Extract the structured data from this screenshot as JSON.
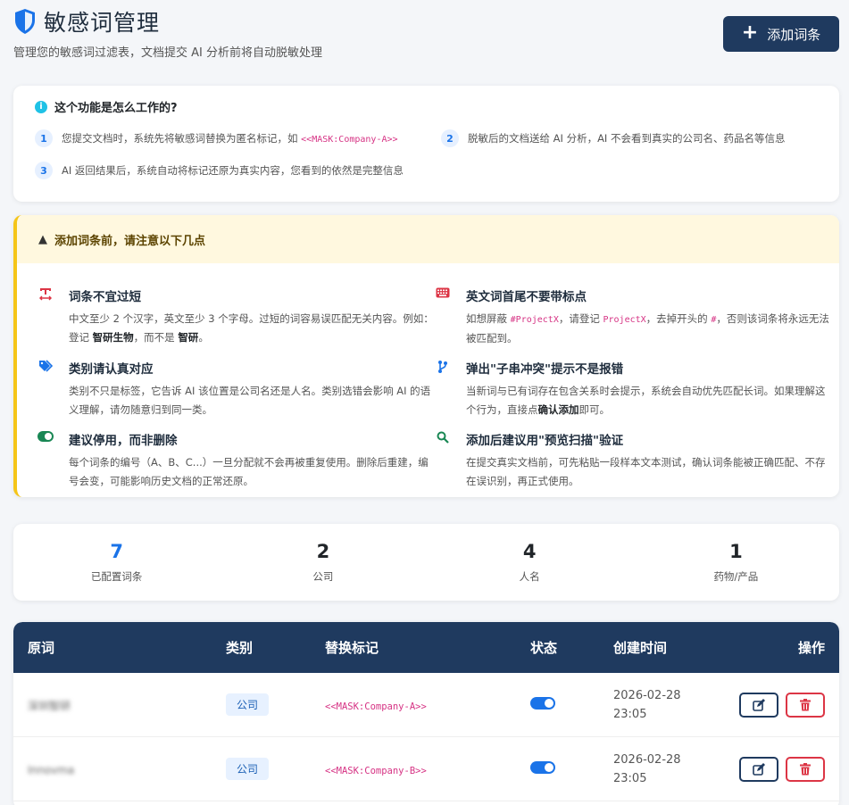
{
  "header": {
    "title": "敏感词管理",
    "subtitle": "管理您的敏感词过滤表，文档提交 AI 分析前将自动脱敏处理",
    "add_button": "添加词条"
  },
  "how_it_works": {
    "title": "这个功能是怎么工作的?",
    "steps": [
      {
        "num": "1",
        "text_before": "您提交文档时，系统先将敏感词替换为匿名标记，如 ",
        "code": "<<MASK:Company-A>>",
        "text_after": ""
      },
      {
        "num": "2",
        "text_before": "脱敏后的文档送给 AI 分析，AI 不会看到真实的公司名、药品名等信息",
        "code": "",
        "text_after": ""
      },
      {
        "num": "3",
        "text_before": "AI 返回结果后，系统自动将标记还原为真实内容，您看到的依然是完整信息",
        "code": "",
        "text_after": ""
      }
    ]
  },
  "warning": {
    "title": "添加词条前，请注意以下几点",
    "tips": [
      {
        "icon": "text-width-icon",
        "color": "#dc3545",
        "title": "词条不宜过短",
        "p1": "中文至少 2 个汉字，英文至少 3 个字母。过短的词容易误匹配无关内容。例如：登记 ",
        "b1": "智研生物",
        "p2": "，而不是 ",
        "b2": "智研",
        "p3": "。"
      },
      {
        "icon": "keyboard-icon",
        "color": "#dc3545",
        "title": "英文词首尾不要带标点",
        "p1": "如想屏蔽 ",
        "c1": "#ProjectX",
        "p2": "，请登记 ",
        "c2": "ProjectX",
        "p3": "，去掉开头的 ",
        "c3": "#",
        "p4": "，否则该词条将永远无法被匹配到。"
      },
      {
        "icon": "tags-icon",
        "color": "#1a73e8",
        "title": "类别请认真对应",
        "p1": "类别不只是标签，它告诉 AI 该位置是公司名还是人名。类别选错会影响 AI 的语义理解，请勿随意归到同一类。"
      },
      {
        "icon": "code-branch-icon",
        "color": "#1a73e8",
        "title": "弹出\"子串冲突\"提示不是报错",
        "p1": "当新词与已有词存在包含关系时会提示，系统会自动优先匹配长词。如果理解这个行为，直接点",
        "b1": "确认添加",
        "p2": "即可。"
      },
      {
        "icon": "toggle-on-icon",
        "color": "#198754",
        "title": "建议停用，而非删除",
        "p1": "每个词条的编号（A、B、C...）一旦分配就不会再被重复使用。删除后重建，编号会变，可能影响历史文档的正常还原。"
      },
      {
        "icon": "search-icon",
        "color": "#198754",
        "title": "添加后建议用\"预览扫描\"验证",
        "p1": "在提交真实文档前，可先粘贴一段样本文本测试，确认词条能被正确匹配、不存在误识别，再正式使用。"
      }
    ]
  },
  "stats": [
    {
      "value": "7",
      "label": "已配置词条"
    },
    {
      "value": "2",
      "label": "公司"
    },
    {
      "value": "4",
      "label": "人名"
    },
    {
      "value": "1",
      "label": "药物/产品"
    }
  ],
  "table": {
    "headers": [
      "原词",
      "类别",
      "替换标记",
      "状态",
      "创建时间",
      "操作"
    ],
    "rows": [
      {
        "word": "深圳智研",
        "category": "公司",
        "mask": "<<MASK:Company-A>>",
        "date": "2026-02-28",
        "time": "23:05"
      },
      {
        "word": "Innovma",
        "category": "公司",
        "mask": "<<MASK:Company-B>>",
        "date": "2026-02-28",
        "time": "23:05"
      }
    ]
  }
}
